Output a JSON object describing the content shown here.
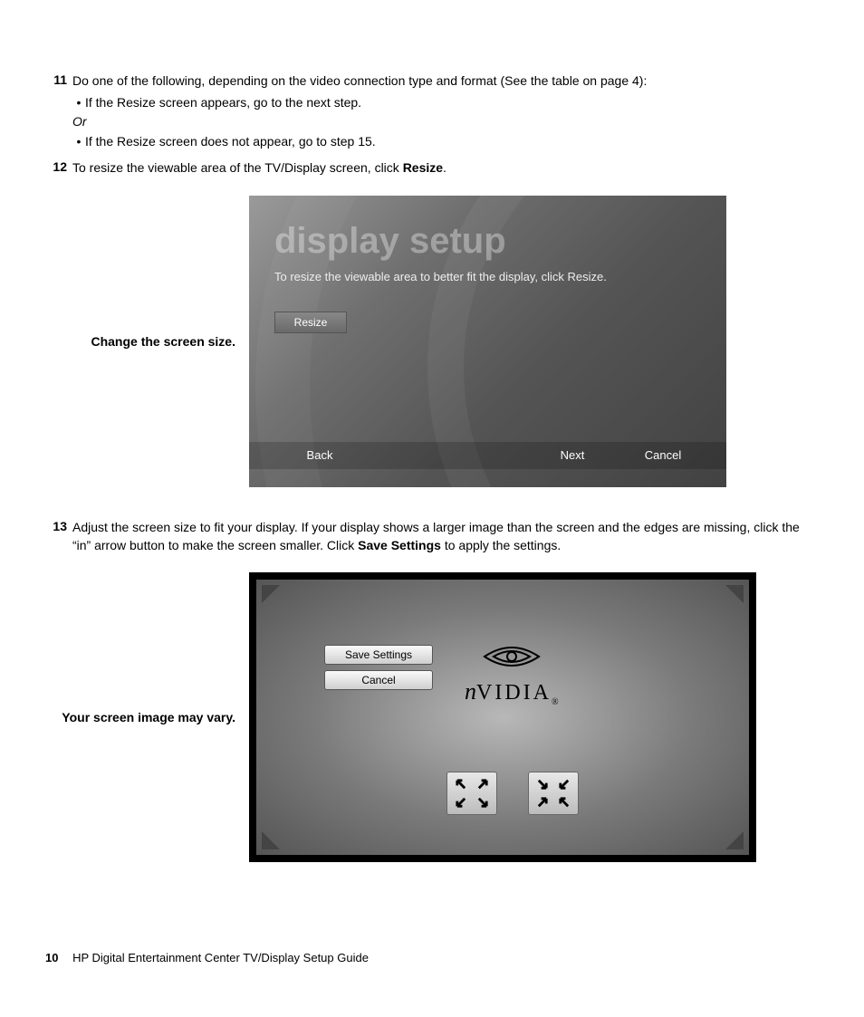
{
  "steps": {
    "s11": {
      "num": "11",
      "intro": "Do one of the following, depending on the video connection type and format (See the table on page 4):",
      "bullet1": "If the Resize screen appears, go to the next step.",
      "or": "Or",
      "bullet2": "If the Resize screen does not appear, go to step 15."
    },
    "s12": {
      "num": "12",
      "text_a": "To resize the viewable area of the TV/Display screen, click ",
      "text_b": "Resize",
      "text_c": "."
    },
    "s13": {
      "num": "13",
      "text_a": "Adjust the screen size to fit your display. If your display shows a larger image than the screen and the edges are missing, click the “in” arrow button to make the screen smaller. Click ",
      "text_b": "Save Settings",
      "text_c": " to apply the settings."
    }
  },
  "fig1": {
    "caption": "Change the screen size.",
    "title": "display setup",
    "subtitle": "To resize the viewable area to better fit the display, click Resize.",
    "resize_btn": "Resize",
    "back": "Back",
    "next": "Next",
    "cancel": "Cancel"
  },
  "fig2": {
    "caption": "Your screen image may vary.",
    "save": "Save Settings",
    "cancel": "Cancel",
    "logo": "VIDIA",
    "logo_reg": "®"
  },
  "footer": {
    "page": "10",
    "title": "HP Digital Entertainment Center TV/Display Setup Guide"
  }
}
